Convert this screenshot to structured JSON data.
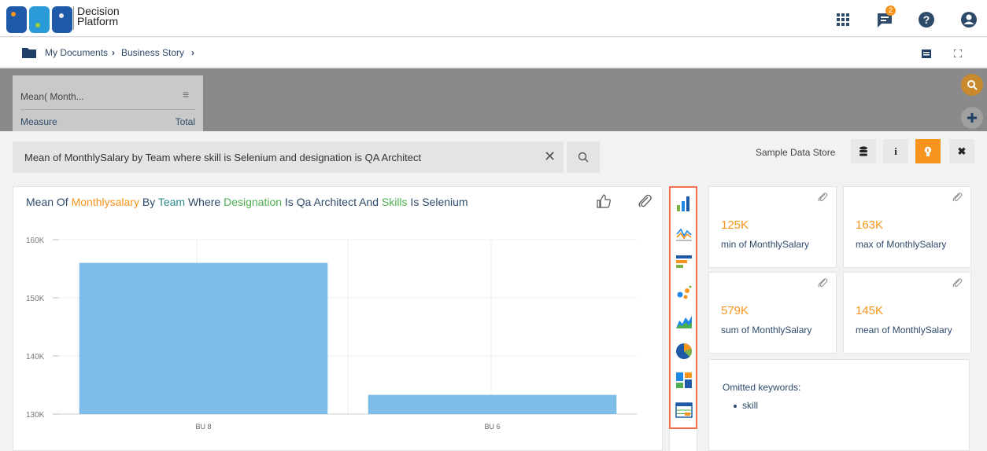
{
  "header": {
    "logo_line1": "Decision",
    "logo_line2": "Platform",
    "notification_count": "2"
  },
  "breadcrumb": {
    "items": [
      "My Documents",
      "Business Story"
    ]
  },
  "overlay_card": {
    "title": "Mean( Month...",
    "col1": "Measure",
    "col2": "Total"
  },
  "search": {
    "query": "Mean of MonthlySalary by Team where skill is Selenium and designation is QA Architect",
    "clear_label": "✕"
  },
  "data_store": {
    "label": "Sample Data Store",
    "info_label": "i",
    "close_label": "✖"
  },
  "chart_panel": {
    "title_parts": [
      "Mean Of ",
      "Monthlysalary",
      " By ",
      "Team",
      " Where ",
      "Designation",
      " Is Qa Architect And ",
      "Skills",
      " Is Selenium"
    ]
  },
  "chart_data": {
    "type": "bar",
    "title": "Mean Of Monthlysalary By Team Where Designation Is Qa Architect And Skills Is Selenium",
    "categories": [
      "BU 8",
      "BU 6"
    ],
    "values": [
      156000,
      133300
    ],
    "ylim": [
      130000,
      160000
    ],
    "yticks": [
      130000,
      140000,
      150000,
      160000
    ],
    "ytick_labels": [
      "130K",
      "140K",
      "150K",
      "160K"
    ],
    "grid": true,
    "bar_color": "#7dbde8"
  },
  "chart_types": [
    "bar-chart-icon",
    "line-chart-icon",
    "horizontal-bar-icon",
    "scatter-chart-icon",
    "area-chart-icon",
    "pie-chart-icon",
    "treemap-icon",
    "table-chart-icon"
  ],
  "kpis": [
    {
      "value": "125K",
      "label": "min of MonthlySalary"
    },
    {
      "value": "163K",
      "label": "max of MonthlySalary"
    },
    {
      "value": "579K",
      "label": "sum of MonthlySalary"
    },
    {
      "value": "145K",
      "label": "mean of MonthlySalary"
    }
  ],
  "omitted": {
    "heading": "Omitted keywords:",
    "items": [
      "skill"
    ]
  },
  "colors": {
    "accent": "#f7941d",
    "text_blue": "#2e4a6b",
    "highlight_border": "#f26c4f"
  }
}
